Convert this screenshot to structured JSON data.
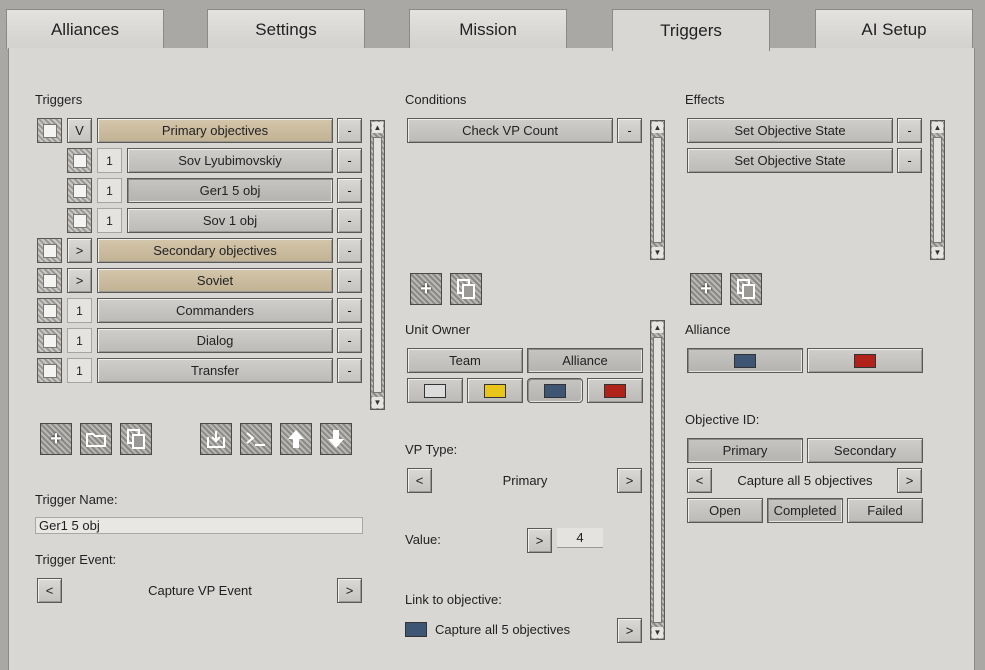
{
  "tabs": [
    {
      "label": "Alliances"
    },
    {
      "label": "Settings"
    },
    {
      "label": "Mission"
    },
    {
      "label": "Triggers"
    },
    {
      "label": "AI Setup"
    }
  ],
  "triggers": {
    "heading": "Triggers",
    "rows": [
      {
        "toggle": "V",
        "label": "Primary objectives",
        "remove": "-"
      },
      {
        "toggle": "1",
        "label": "Sov Lyubimovskiy",
        "remove": "-"
      },
      {
        "toggle": "1",
        "label": "Ger1 5 obj",
        "remove": "-"
      },
      {
        "toggle": "1",
        "label": "Sov  1 obj",
        "remove": "-"
      },
      {
        "toggle": ">",
        "label": "Secondary objectives",
        "remove": "-"
      },
      {
        "toggle": ">",
        "label": "Soviet",
        "remove": "-"
      },
      {
        "toggle": "1",
        "label": "Commanders",
        "remove": "-"
      },
      {
        "toggle": "1",
        "label": "Dialog",
        "remove": "-"
      },
      {
        "toggle": "1",
        "label": "Transfer",
        "remove": "-"
      }
    ],
    "name_label": "Trigger Name:",
    "name_value": "Ger1 5 obj",
    "event_label": "Trigger Event:",
    "event_value": "Capture VP Event",
    "prev": "<",
    "next": ">"
  },
  "conditions": {
    "heading": "Conditions",
    "items": [
      {
        "label": "Check VP Count",
        "remove": "-"
      }
    ],
    "unit_owner_label": "Unit Owner",
    "team_label": "Team",
    "alliance_label": "Alliance",
    "owner_colors": [
      "#dcdcdc",
      "#e8c51a",
      "#3e5673",
      "#b1231a"
    ],
    "vp_type_label": "VP Type:",
    "vp_type_value": "Primary",
    "value_label": "Value:",
    "value": "4",
    "link_label": "Link to objective:",
    "link_value": "Capture all 5 objectives",
    "link_color": "#3e5673",
    "prev": "<",
    "next": ">"
  },
  "effects": {
    "heading": "Effects",
    "items": [
      {
        "label": "Set Objective State",
        "remove": "-"
      },
      {
        "label": "Set Objective State",
        "remove": "-"
      }
    ],
    "alliance_label": "Alliance",
    "alliance_colors": [
      "#3e5673",
      "#b1231a"
    ],
    "objective_id_label": "Objective ID:",
    "primary_label": "Primary",
    "secondary_label": "Secondary",
    "objective_value": "Capture all 5 objectives",
    "states": [
      "Open",
      "Completed",
      "Failed"
    ],
    "prev": "<",
    "next": ">"
  },
  "icons": {
    "add": "plus-icon",
    "folder": "folder-icon",
    "copy": "copy-icon",
    "import": "import-icon",
    "console": "console-icon",
    "up": "arrow-up-icon",
    "down": "arrow-down-icon"
  }
}
